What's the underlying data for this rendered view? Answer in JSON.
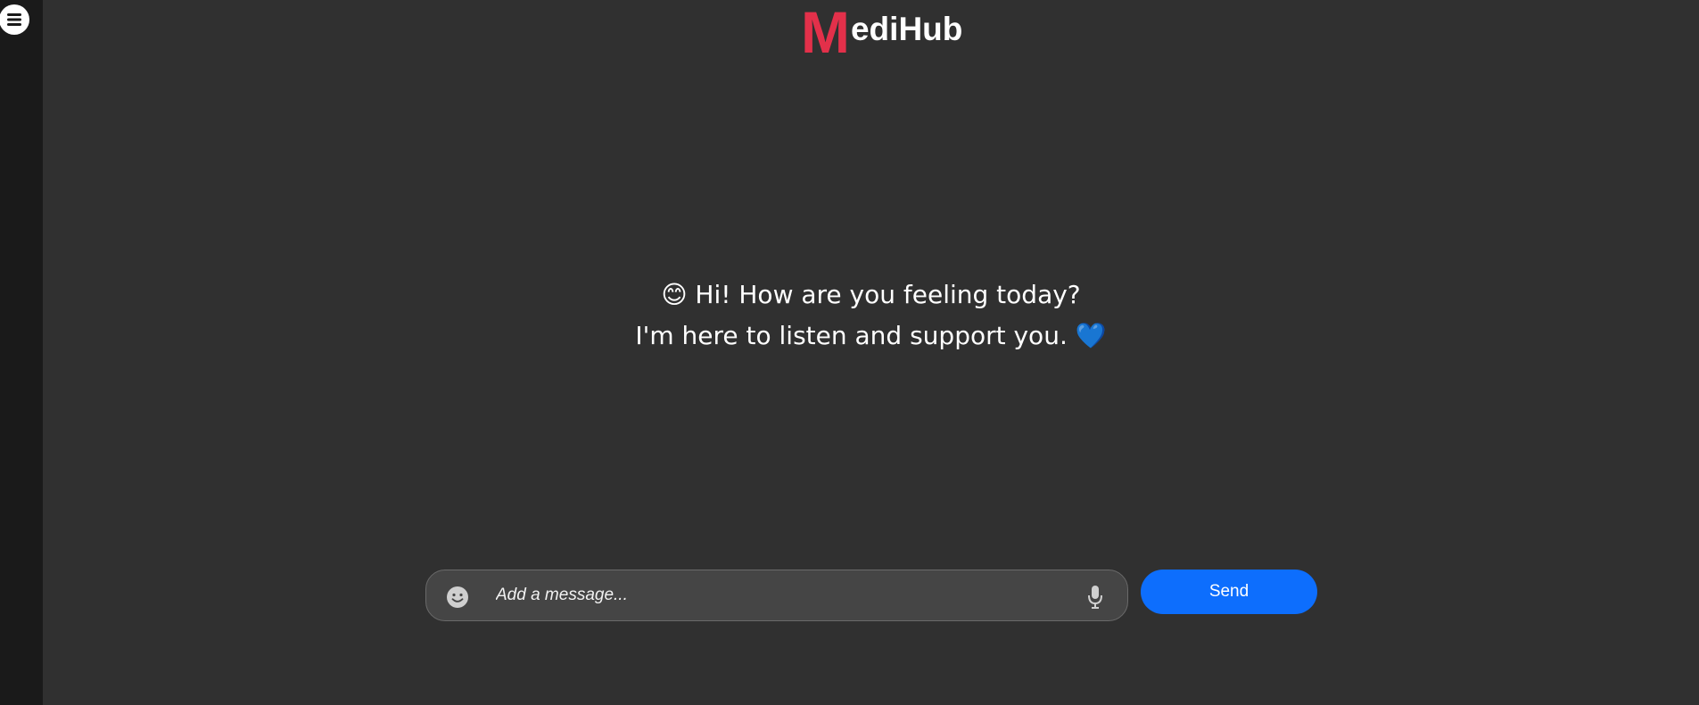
{
  "app": {
    "logo_initial": "M",
    "logo_rest": "ediHub"
  },
  "sidebar": {
    "menu_icon": "hamburger-menu-icon"
  },
  "greeting": {
    "line1": "😊 Hi! How are you feeling today?",
    "line2": "I'm here to listen and support you. 💙"
  },
  "composer": {
    "placeholder": "Add a message...",
    "value": "",
    "emoji_icon": "smiley-icon",
    "mic_icon": "microphone-icon",
    "send_label": "Send"
  },
  "colors": {
    "background": "#303030",
    "sidebar": "#1a1a1a",
    "logo_accent": "#e3304a",
    "send_button": "#0d6efd",
    "input_background": "#454545"
  }
}
